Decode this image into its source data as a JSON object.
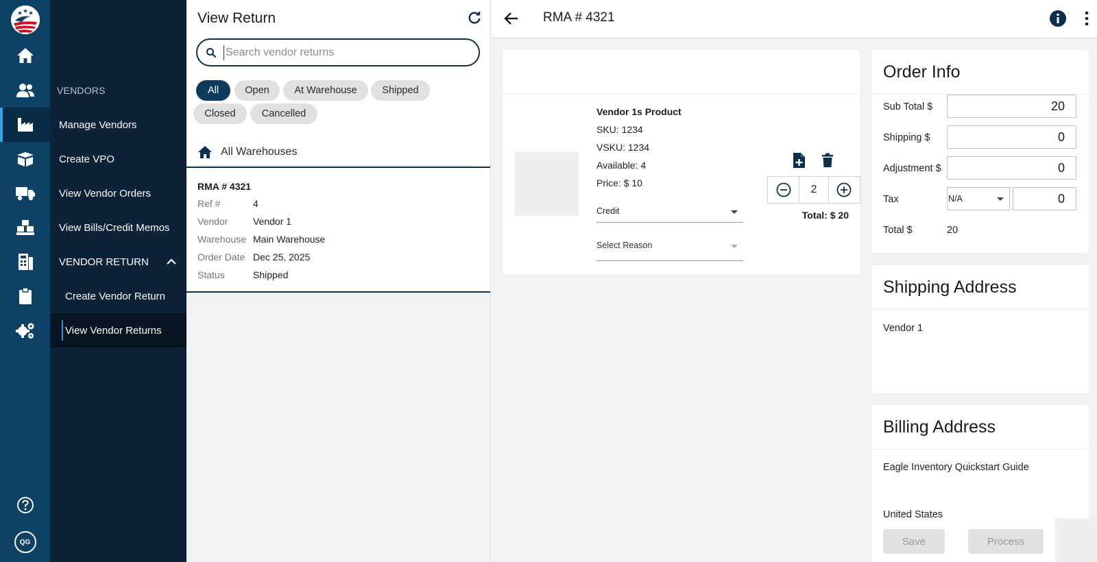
{
  "sidebar": {
    "icons": [
      "logo-eagle",
      "home-icon",
      "users-icon",
      "factory-icon",
      "box-icon",
      "truck-icon",
      "warehouse-icon",
      "register-icon",
      "clipboard-icon",
      "settings-icon",
      "help-icon"
    ],
    "user_initials": "QG",
    "section_label": "VENDORS",
    "items": [
      {
        "label": "Manage Vendors"
      },
      {
        "label": "Create VPO"
      },
      {
        "label": "View Vendor Orders"
      },
      {
        "label": "View Bills/Credit Memos"
      },
      {
        "label": "VENDOR RETURN"
      },
      {
        "label": "Create Vendor Return"
      },
      {
        "label": "View Vendor Returns"
      }
    ]
  },
  "list": {
    "title": "View Return",
    "search_placeholder": "Search vendor returns",
    "filters": [
      "All",
      "Open",
      "At Warehouse",
      "Shipped",
      "Closed",
      "Cancelled"
    ],
    "active_filter": "All",
    "warehouse_label": "All Warehouses",
    "card": {
      "title": "RMA # 4321",
      "rows": [
        {
          "k": "Ref #",
          "v": "4"
        },
        {
          "k": "Vendor",
          "v": "Vendor 1"
        },
        {
          "k": "Warehouse",
          "v": "Main Warehouse"
        },
        {
          "k": "Order Date",
          "v": "Dec 25, 2025"
        },
        {
          "k": "Status",
          "v": "Shipped"
        }
      ]
    }
  },
  "detail": {
    "title": "RMA # 4321",
    "product": {
      "name": "Vendor 1s Product",
      "sku": "SKU: 1234",
      "vsku": "VSKU: 1234",
      "available": "Available: 4",
      "price": "Price: $ 10",
      "type_value": "Credit",
      "reason_placeholder": "Select Reason",
      "quantity": "2",
      "total": "Total: $ 20"
    },
    "order_info": {
      "title": "Order Info",
      "sub_total_label": "Sub Total $",
      "sub_total": "20",
      "shipping_label": "Shipping $",
      "shipping": "0",
      "adjustment_label": "Adjustment $",
      "adjustment": "0",
      "tax_label": "Tax",
      "tax_type": "N/A",
      "tax": "0",
      "total_label": "Total $",
      "total": "20"
    },
    "shipping_address": {
      "title": "Shipping Address",
      "line1": "Vendor 1"
    },
    "billing_address": {
      "title": "Billing Address",
      "line1": "Eagle Inventory Quickstart Guide",
      "line2": "United States"
    },
    "buttons": {
      "save": "Save",
      "process": "Process"
    }
  },
  "colors": {
    "rail": "#0d4266",
    "nav": "#0b2238",
    "accent": "#0d3b5e"
  }
}
